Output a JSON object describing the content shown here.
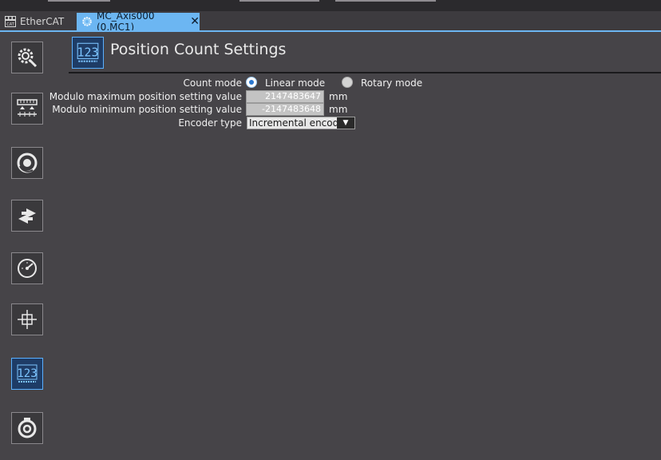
{
  "tabs": [
    {
      "label": "EtherCAT",
      "icon": "ethercat-icon",
      "active": false
    },
    {
      "label": "MC_Axis000 (0,MC1)",
      "icon": "gear-icon",
      "active": true,
      "close_glyph": "✕"
    }
  ],
  "sidebar": {
    "items": [
      {
        "name": "axis-basic-settings",
        "icon": "gear-search-icon",
        "active": false
      },
      {
        "name": "unit-conversion-settings",
        "icon": "scale-ruler-icon",
        "active": false
      },
      {
        "name": "operation-settings",
        "icon": "motor-icon",
        "active": false
      },
      {
        "name": "other-operation-settings",
        "icon": "arrows-swap-icon",
        "active": false
      },
      {
        "name": "limit-settings",
        "icon": "speedometer-icon",
        "active": false
      },
      {
        "name": "homing-settings",
        "icon": "crosshair-icon",
        "active": false
      },
      {
        "name": "position-count-settings",
        "icon": "counter-123-icon",
        "active": true
      },
      {
        "name": "servo-drive-settings",
        "icon": "servo-drive-icon",
        "active": false
      }
    ]
  },
  "header": {
    "title": "Position Count Settings",
    "icon": "counter-123-icon"
  },
  "form": {
    "count_mode": {
      "label": "Count mode",
      "options": [
        {
          "label": "Linear mode",
          "checked": true
        },
        {
          "label": "Rotary mode",
          "checked": false
        }
      ]
    },
    "modulo_max": {
      "label": "Modulo maximum position setting value",
      "value": "2147483647",
      "unit": "mm"
    },
    "modulo_min": {
      "label": "Modulo minimum position setting value",
      "value": "-2147483648",
      "unit": "mm"
    },
    "encoder_type": {
      "label": "Encoder type",
      "value": "Incremental encoder",
      "options": [
        "Incremental encoder"
      ]
    }
  },
  "colors": {
    "accent": "#6cb6f2",
    "background": "#464448",
    "active_icon": "#1e3c66"
  }
}
